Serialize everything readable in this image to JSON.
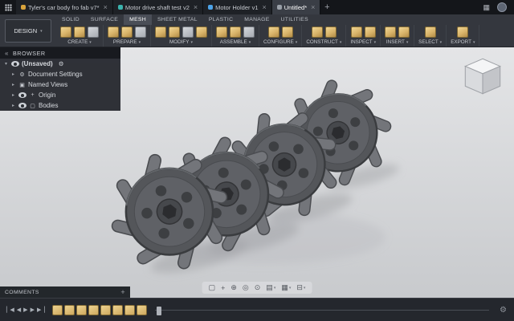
{
  "glyphs": {
    "close": "×",
    "plus": "+",
    "caret_down": "▾",
    "collapse": "«",
    "gear": "⚙"
  },
  "colors": {
    "tool_icon_accent": "#d9b46a",
    "canvas_top": "#e4e5e7",
    "canvas_bottom": "#c8cacd"
  },
  "tabbar": {
    "tabs": [
      {
        "label": "Tyler's car body fro fab v7*",
        "icon_color": "#d8a33c",
        "active": false
      },
      {
        "label": "Motor drive shaft test v2",
        "icon_color": "#3bb3ad",
        "active": false
      },
      {
        "label": "Motor Holder v1",
        "icon_color": "#4da3e8",
        "active": false
      },
      {
        "label": "Untitled*",
        "icon_color": "#9aa0a8",
        "active": true
      }
    ]
  },
  "ribbon": {
    "design_label": "DESIGN",
    "context_tabs": [
      {
        "label": "SOLID",
        "active": false
      },
      {
        "label": "SURFACE",
        "active": false
      },
      {
        "label": "MESH",
        "active": true
      },
      {
        "label": "SHEET METAL",
        "active": false
      },
      {
        "label": "PLASTIC",
        "active": false
      },
      {
        "label": "MANAGE",
        "active": false
      },
      {
        "label": "UTILITIES",
        "active": false
      }
    ],
    "groups": [
      {
        "label": "CREATE",
        "icon_count": 3
      },
      {
        "label": "PREPARE",
        "icon_count": 3
      },
      {
        "label": "MODIFY",
        "icon_count": 4
      },
      {
        "label": "ASSEMBLE",
        "icon_count": 3
      },
      {
        "label": "CONFIGURE",
        "icon_count": 2
      },
      {
        "label": "CONSTRUCT",
        "icon_count": 2
      },
      {
        "label": "INSPECT",
        "icon_count": 2
      },
      {
        "label": "INSERT",
        "icon_count": 2
      },
      {
        "label": "SELECT",
        "icon_count": 1
      },
      {
        "label": "EXPORT",
        "icon_count": 1
      }
    ]
  },
  "browser": {
    "title": "BROWSER",
    "items": [
      {
        "label": "(Unsaved)",
        "caret": "▾",
        "eye": true,
        "bold": true,
        "badge": "⚙",
        "indent": 0
      },
      {
        "label": "Document Settings",
        "caret": "▸",
        "eye": false,
        "icon": "⚙",
        "icon_name": "document-settings-icon",
        "indent": 1
      },
      {
        "label": "Named Views",
        "caret": "▸",
        "eye": false,
        "icon": "▣",
        "icon_name": "named-views-icon",
        "indent": 1
      },
      {
        "label": "Origin",
        "caret": "▸",
        "eye": true,
        "icon": "+",
        "icon_name": "origin-axes-icon",
        "indent": 1
      },
      {
        "label": "Bodies",
        "caret": "▸",
        "eye": true,
        "icon": "▢",
        "icon_name": "bodies-icon",
        "indent": 1
      }
    ]
  },
  "navbar": {
    "items": [
      {
        "name": "fit-view-icon",
        "glyph": "▢",
        "caret": false
      },
      {
        "name": "pan-icon",
        "glyph": "+",
        "caret": false
      },
      {
        "name": "zoom-icon",
        "glyph": "⊕",
        "caret": false
      },
      {
        "name": "orbit-icon",
        "glyph": "◎",
        "caret": false
      },
      {
        "name": "look-at-icon",
        "glyph": "⊙",
        "caret": false
      },
      {
        "name": "display-settings-icon",
        "glyph": "▤",
        "caret": true
      },
      {
        "name": "grid-settings-icon",
        "glyph": "▦",
        "caret": true
      },
      {
        "name": "viewports-icon",
        "glyph": "⊟",
        "caret": true
      }
    ]
  },
  "comments": {
    "label": "COMMENTS"
  },
  "timeline": {
    "controls": [
      {
        "name": "go-to-start-button",
        "glyph": "▏◀"
      },
      {
        "name": "step-back-button",
        "glyph": "◀"
      },
      {
        "name": "play-button",
        "glyph": "▶"
      },
      {
        "name": "step-forward-button",
        "glyph": "▶"
      },
      {
        "name": "go-to-end-button",
        "glyph": "▶▕"
      }
    ],
    "feature_count": 8
  }
}
